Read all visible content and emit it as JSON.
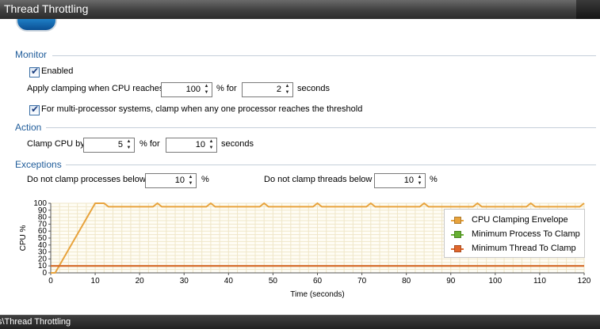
{
  "window": {
    "title": "Thread Throttling"
  },
  "monitor": {
    "section_title": "Monitor",
    "enabled_label": "Enabled",
    "enabled_checked": true,
    "apply_prefix": "Apply clamping when CPU reaches",
    "cpu_threshold": "100",
    "percent_for": "% for",
    "duration": "2",
    "seconds": "seconds",
    "multi_label": "For multi-processor systems, clamp when any one processor reaches the threshold",
    "multi_checked": true
  },
  "action": {
    "section_title": "Action",
    "clamp_label": "Clamp CPU by",
    "clamp_value": "5",
    "percent_for": "% for",
    "clamp_duration": "10",
    "seconds": "seconds"
  },
  "exceptions": {
    "section_title": "Exceptions",
    "processes_label": "Do not clamp processes below",
    "processes_value": "10",
    "processes_unit": "%",
    "threads_label": "Do not clamp threads below",
    "threads_value": "10",
    "threads_unit": "%"
  },
  "chart_data": {
    "type": "line",
    "xlabel": "Time (seconds)",
    "ylabel": "CPU %",
    "xlim": [
      0,
      120
    ],
    "ylim": [
      0,
      100
    ],
    "x_ticks": [
      0,
      10,
      20,
      30,
      40,
      50,
      60,
      70,
      80,
      90,
      100,
      110,
      120
    ],
    "y_ticks": [
      0,
      10,
      20,
      30,
      40,
      50,
      60,
      70,
      80,
      90,
      100
    ],
    "grid": true,
    "legend_position": "right",
    "series": [
      {
        "name": "CPU Clamping Envelope",
        "color": "#e8a33c",
        "points": [
          [
            0,
            0
          ],
          [
            1,
            0
          ],
          [
            10,
            100
          ],
          [
            12,
            100
          ],
          [
            13,
            95
          ],
          [
            23,
            95
          ],
          [
            24,
            100
          ],
          [
            25,
            95
          ],
          [
            35,
            95
          ],
          [
            36,
            100
          ],
          [
            37,
            95
          ],
          [
            47,
            95
          ],
          [
            48,
            100
          ],
          [
            49,
            95
          ],
          [
            59,
            95
          ],
          [
            60,
            100
          ],
          [
            61,
            95
          ],
          [
            71,
            95
          ],
          [
            72,
            100
          ],
          [
            73,
            95
          ],
          [
            83,
            95
          ],
          [
            84,
            100
          ],
          [
            85,
            95
          ],
          [
            95,
            95
          ],
          [
            96,
            100
          ],
          [
            97,
            95
          ],
          [
            107,
            95
          ],
          [
            108,
            100
          ],
          [
            109,
            95
          ],
          [
            119,
            95
          ],
          [
            120,
            100
          ]
        ]
      },
      {
        "name": "Minimum Process To Clamp",
        "color": "#66b032",
        "points": [
          [
            0,
            10
          ],
          [
            120,
            10
          ]
        ]
      },
      {
        "name": "Minimum Thread To Clamp",
        "color": "#e0662b",
        "points": [
          [
            0,
            10
          ],
          [
            120,
            10
          ]
        ]
      }
    ]
  },
  "status": {
    "path": "s\\Thread Throttling"
  }
}
